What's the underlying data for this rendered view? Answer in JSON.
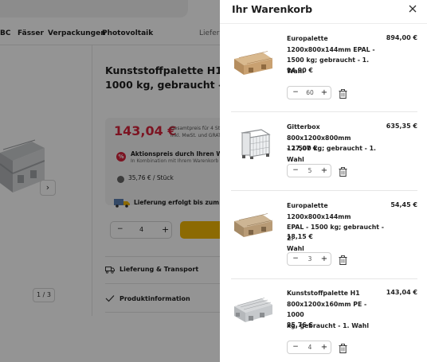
{
  "background_page": {
    "nav": {
      "items": [
        "BC",
        "Fässer",
        "Verpackungen",
        "Photovoltaik"
      ],
      "right_link": "Lieferu"
    },
    "gallery": {
      "next_arrow": "›",
      "pager": "1 / 3"
    },
    "product": {
      "title_line1": "Kunststoffpalette H1 800",
      "title_line2": "1000 kg, gebraucht - 1. W",
      "price": "143,04 €",
      "price_note_line1": "Gesamtpreis für 4 St",
      "price_note_line2": "inkl. MwSt. und GRAT",
      "promo_icon": "%",
      "promo_title": "Aktionspreis durch Ihren Ware",
      "promo_sub": "In Kombination mit Ihrem Warenkorb (",
      "unit_price": "35,76 € / Stück",
      "delivery": "Lieferung erfolgt bis zum 27.0",
      "qty_minus": "−",
      "qty_value": "4",
      "qty_plus": "+",
      "accordion": [
        "Lieferung & Transport",
        "Produktinformation"
      ]
    }
  },
  "cart": {
    "title": "Ihr Warenkorb",
    "close_icon": "close-icon",
    "items": [
      {
        "name_lines": [
          "Europalette",
          "1200x800x144mm EPAL -",
          "1500 kg; gebraucht - 1. Wahl"
        ],
        "total": "894,00 €",
        "unit_price": "14,90 €",
        "qty": "60",
        "image": "euro-pallet"
      },
      {
        "name_lines": [
          "Gitterbox 800x1200x800mm",
          "- 1.500 kg; gebraucht - 1. Wahl"
        ],
        "total": "635,35 €",
        "unit_price": "127,07 €",
        "qty": "5",
        "image": "gitterbox"
      },
      {
        "name_lines": [
          "Europalette 1200x800x144mm",
          "EPAL - 1500 kg; gebraucht - 2.",
          "Wahl"
        ],
        "total": "54,45 €",
        "unit_price": "18,15 €",
        "qty": "3",
        "image": "euro-pallet"
      },
      {
        "name_lines": [
          "Kunststoffpalette H1",
          "800x1200x160mm PE - 1000",
          "kg, gebraucht - 1. Wahl"
        ],
        "total": "143,04 €",
        "unit_price": "35,76 €",
        "qty": "4",
        "image": "plastic-pallet"
      }
    ],
    "stepper": {
      "minus": "−",
      "plus": "+"
    }
  },
  "colors": {
    "accent_red": "#d6243b",
    "cta_yellow": "#f2b705",
    "overlay": "rgba(0,0,0,0.42)"
  }
}
